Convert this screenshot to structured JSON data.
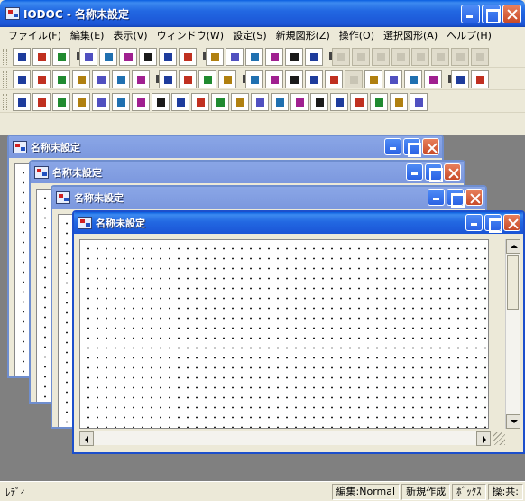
{
  "app": {
    "title": "IODOC - 名称未設定"
  },
  "menu": [
    "ファイル(F)",
    "編集(E)",
    "表示(V)",
    "ウィンドウ(W)",
    "設定(S)",
    "新規図形(Z)",
    "操作(O)",
    "選択図形(A)",
    "ヘルプ(H)"
  ],
  "toolbars": {
    "standard": [
      "new-icon",
      "open-icon",
      "save-icon",
      "sep",
      "cut-icon",
      "copy-icon",
      "paste-icon",
      "print-icon",
      "doc-icon",
      "help-icon",
      "sep",
      "view1-icon",
      "view2-icon",
      "view3-icon",
      "view4-icon",
      "view5-icon",
      "view6-icon",
      "sep",
      "gray1-icon",
      "gray2-icon",
      "gray3-icon",
      "gray4-icon",
      "gray5-icon",
      "gray6-icon",
      "gray7-icon",
      "gray8-icon"
    ],
    "drawing": [
      "ddd-icon",
      "nine99-icon",
      "grid-icon",
      "grid2-icon",
      "zoom-in-icon",
      "rect-select-icon",
      "zoom-icon",
      "sep",
      "layer1-icon",
      "layer2-icon",
      "layer3-icon",
      "layer4-icon",
      "sep",
      "green1-icon",
      "green2-icon",
      "green3-icon",
      "green4-icon",
      "green5-icon",
      "gray-icon",
      "green6-icon",
      "red-x-icon",
      "green7-icon",
      "green8-icon",
      "sep",
      "arrow-icon",
      "corner-icon"
    ],
    "shapes": [
      "text-a-icon",
      "text-ab-icon",
      "shape3-icon",
      "line-h-icon",
      "bar-icon",
      "slash-icon",
      "rect-icon",
      "rrect-icon",
      "diamond-icon",
      "circle-icon",
      "ellipse-icon",
      "shape12-icon",
      "shape13-icon",
      "shape14-icon",
      "shape15-icon",
      "shape16-icon",
      "shape17-icon",
      "shape18-icon",
      "shape19-icon",
      "shape20-icon",
      "shape21-icon"
    ]
  },
  "children": [
    {
      "title": "名称未設定"
    },
    {
      "title": "名称未設定"
    },
    {
      "title": "名称未設定"
    },
    {
      "title": "名称未設定"
    }
  ],
  "status": {
    "main": "ﾚﾃﾞｨ",
    "edit": "編集:Normal",
    "new_shape": "新規作成",
    "box": "ﾎﾞｯｸｽ",
    "op": "操:共:"
  },
  "colors": {
    "title_active": "#1b55d6",
    "title_inactive": "#7c98de"
  }
}
